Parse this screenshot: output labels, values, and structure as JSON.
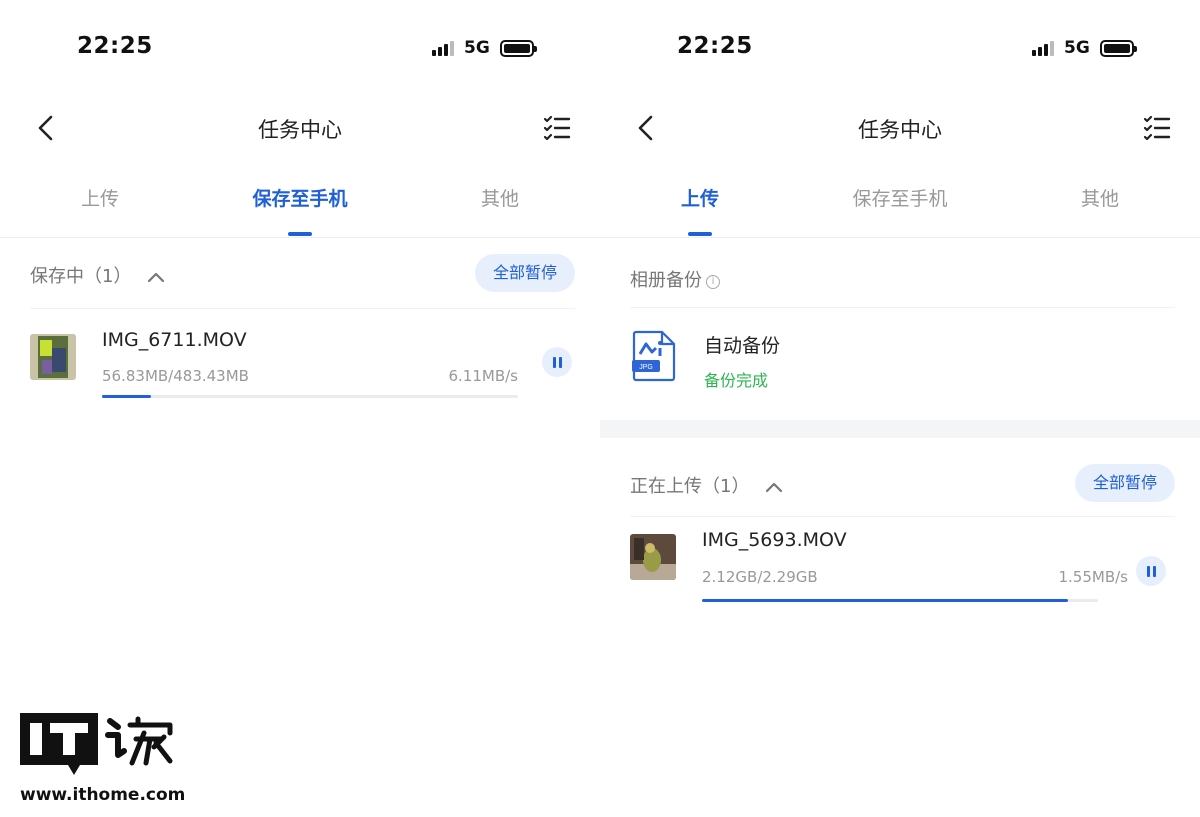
{
  "left_screen": {
    "status": {
      "time": "22:25",
      "network": "5G"
    },
    "title": "任务中心",
    "tabs": [
      {
        "label": "上传",
        "active": false
      },
      {
        "label": "保存至手机",
        "active": true
      },
      {
        "label": "其他",
        "active": false
      }
    ],
    "section": {
      "title": "保存中（1）",
      "button": "全部暂停"
    },
    "file": {
      "name": "IMG_6711.MOV",
      "size": "56.83MB/483.43MB",
      "speed": "6.11MB/s",
      "progress": 0.118
    }
  },
  "right_screen": {
    "status": {
      "time": "22:25",
      "network": "5G"
    },
    "title": "任务中心",
    "tabs": [
      {
        "label": "上传",
        "active": true
      },
      {
        "label": "保存至手机",
        "active": false
      },
      {
        "label": "其他",
        "active": false
      }
    ],
    "backup": {
      "section_title": "相册备份",
      "info": "i",
      "title": "自动备份",
      "status": "备份完成",
      "icon_badge": "JPG"
    },
    "section": {
      "title": "正在上传（1）",
      "button": "全部暂停"
    },
    "file": {
      "name": "IMG_5693.MOV",
      "size": "2.12GB/2.29GB",
      "speed": "1.55MB/s",
      "progress": 0.925
    }
  },
  "watermark": {
    "url": "www.ithome.com",
    "logo_text": "IT之家"
  },
  "colors": {
    "accent": "#1f5fd8",
    "pill_bg": "#e7effd",
    "success": "#2db552",
    "muted": "#999999"
  }
}
